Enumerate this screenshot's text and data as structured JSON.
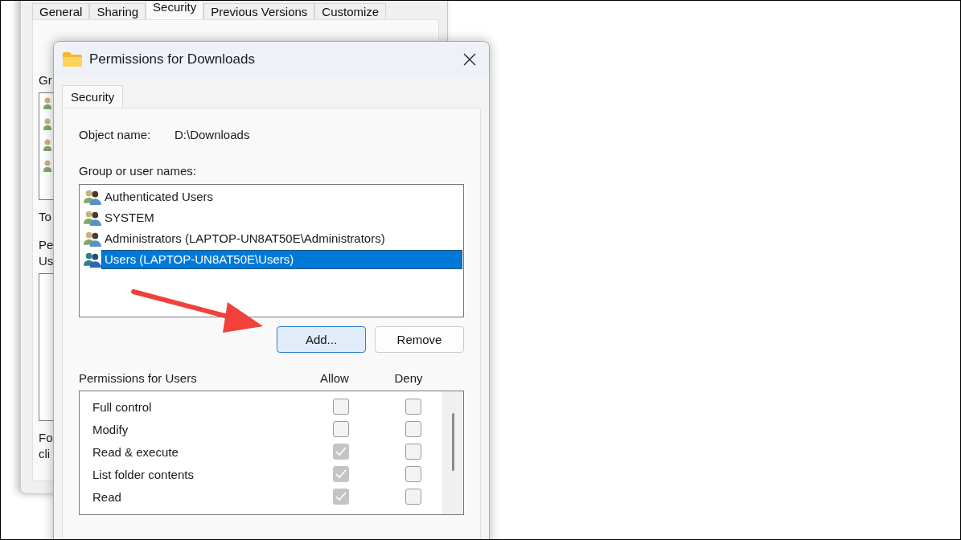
{
  "background_window": {
    "tabs": [
      {
        "label": "General",
        "selected": false
      },
      {
        "label": "Sharing",
        "selected": false
      },
      {
        "label": "Security",
        "selected": true
      },
      {
        "label": "Previous Versions",
        "selected": false
      },
      {
        "label": "Customize",
        "selected": false
      }
    ],
    "cut_texts": [
      "Gr",
      "To",
      "Pe",
      "Us",
      "Fo",
      "cli"
    ]
  },
  "dialog": {
    "title": "Permissions for Downloads",
    "tabs": [
      {
        "label": "Security",
        "selected": true
      }
    ],
    "object_name_label": "Object name:",
    "object_name_value": "D:\\Downloads",
    "group_label": "Group or user names:",
    "users": [
      {
        "name": "Authenticated Users",
        "selected": false
      },
      {
        "name": "SYSTEM",
        "selected": false
      },
      {
        "name": "Administrators (LAPTOP-UN8AT50E\\Administrators)",
        "selected": false
      },
      {
        "name": "Users (LAPTOP-UN8AT50E\\Users)",
        "selected": true
      }
    ],
    "buttons": [
      {
        "label": "Add...",
        "focused": true
      },
      {
        "label": "Remove",
        "focused": false
      }
    ],
    "permissions_label": "Permissions for Users",
    "allow_header": "Allow",
    "deny_header": "Deny",
    "permissions": [
      {
        "name": "Full control",
        "allow": false,
        "deny": false
      },
      {
        "name": "Modify",
        "allow": false,
        "deny": false
      },
      {
        "name": "Read & execute",
        "allow": true,
        "deny": false
      },
      {
        "name": "List folder contents",
        "allow": true,
        "deny": false
      },
      {
        "name": "Read",
        "allow": true,
        "deny": false
      }
    ]
  }
}
